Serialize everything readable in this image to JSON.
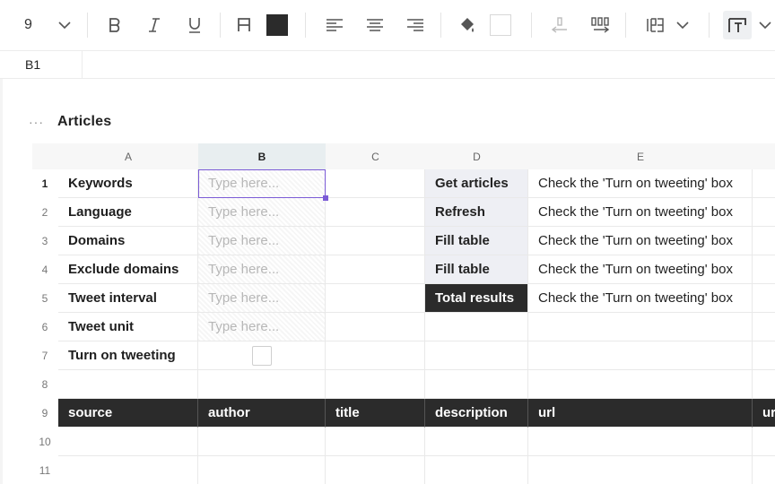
{
  "toolbar": {
    "font_size": "9",
    "icons": [
      "chevron-down-icon",
      "bold-icon",
      "italic-icon",
      "underline-icon",
      "text-color-icon",
      "align-left-icon",
      "align-center-icon",
      "align-right-icon",
      "fill-color-icon",
      "decrease-decimal-icon",
      "increase-decimal-icon",
      "number-format-icon",
      "text-wrap-icon"
    ],
    "text_color": "#2b2b2b",
    "fill_color": "#ffffff"
  },
  "formula_bar": {
    "cell_ref": "B1",
    "value": ""
  },
  "sheet": {
    "menu_icon": "···",
    "title": "Articles",
    "columns": [
      "A",
      "B",
      "C",
      "D",
      "E"
    ],
    "selected_column": "B",
    "rows": [
      "1",
      "2",
      "3",
      "4",
      "5",
      "6",
      "7",
      "8",
      "9",
      "10",
      "11"
    ],
    "selected_row": "1",
    "labels": [
      "Keywords",
      "Language",
      "Domains",
      "Exclude domains",
      "Tweet interval",
      "Tweet unit",
      "Turn on tweeting"
    ],
    "placeholder": "Type here...",
    "actions": [
      "Get articles",
      "Refresh",
      "Fill table",
      "Fill table",
      "Total results"
    ],
    "action_note": "Check the 'Turn on tweeting' box",
    "table_headers": [
      "source",
      "author",
      "title",
      "description",
      "url",
      "ur"
    ],
    "accent_color": "#7b5bd6",
    "dark_color": "#2b2b2b"
  }
}
